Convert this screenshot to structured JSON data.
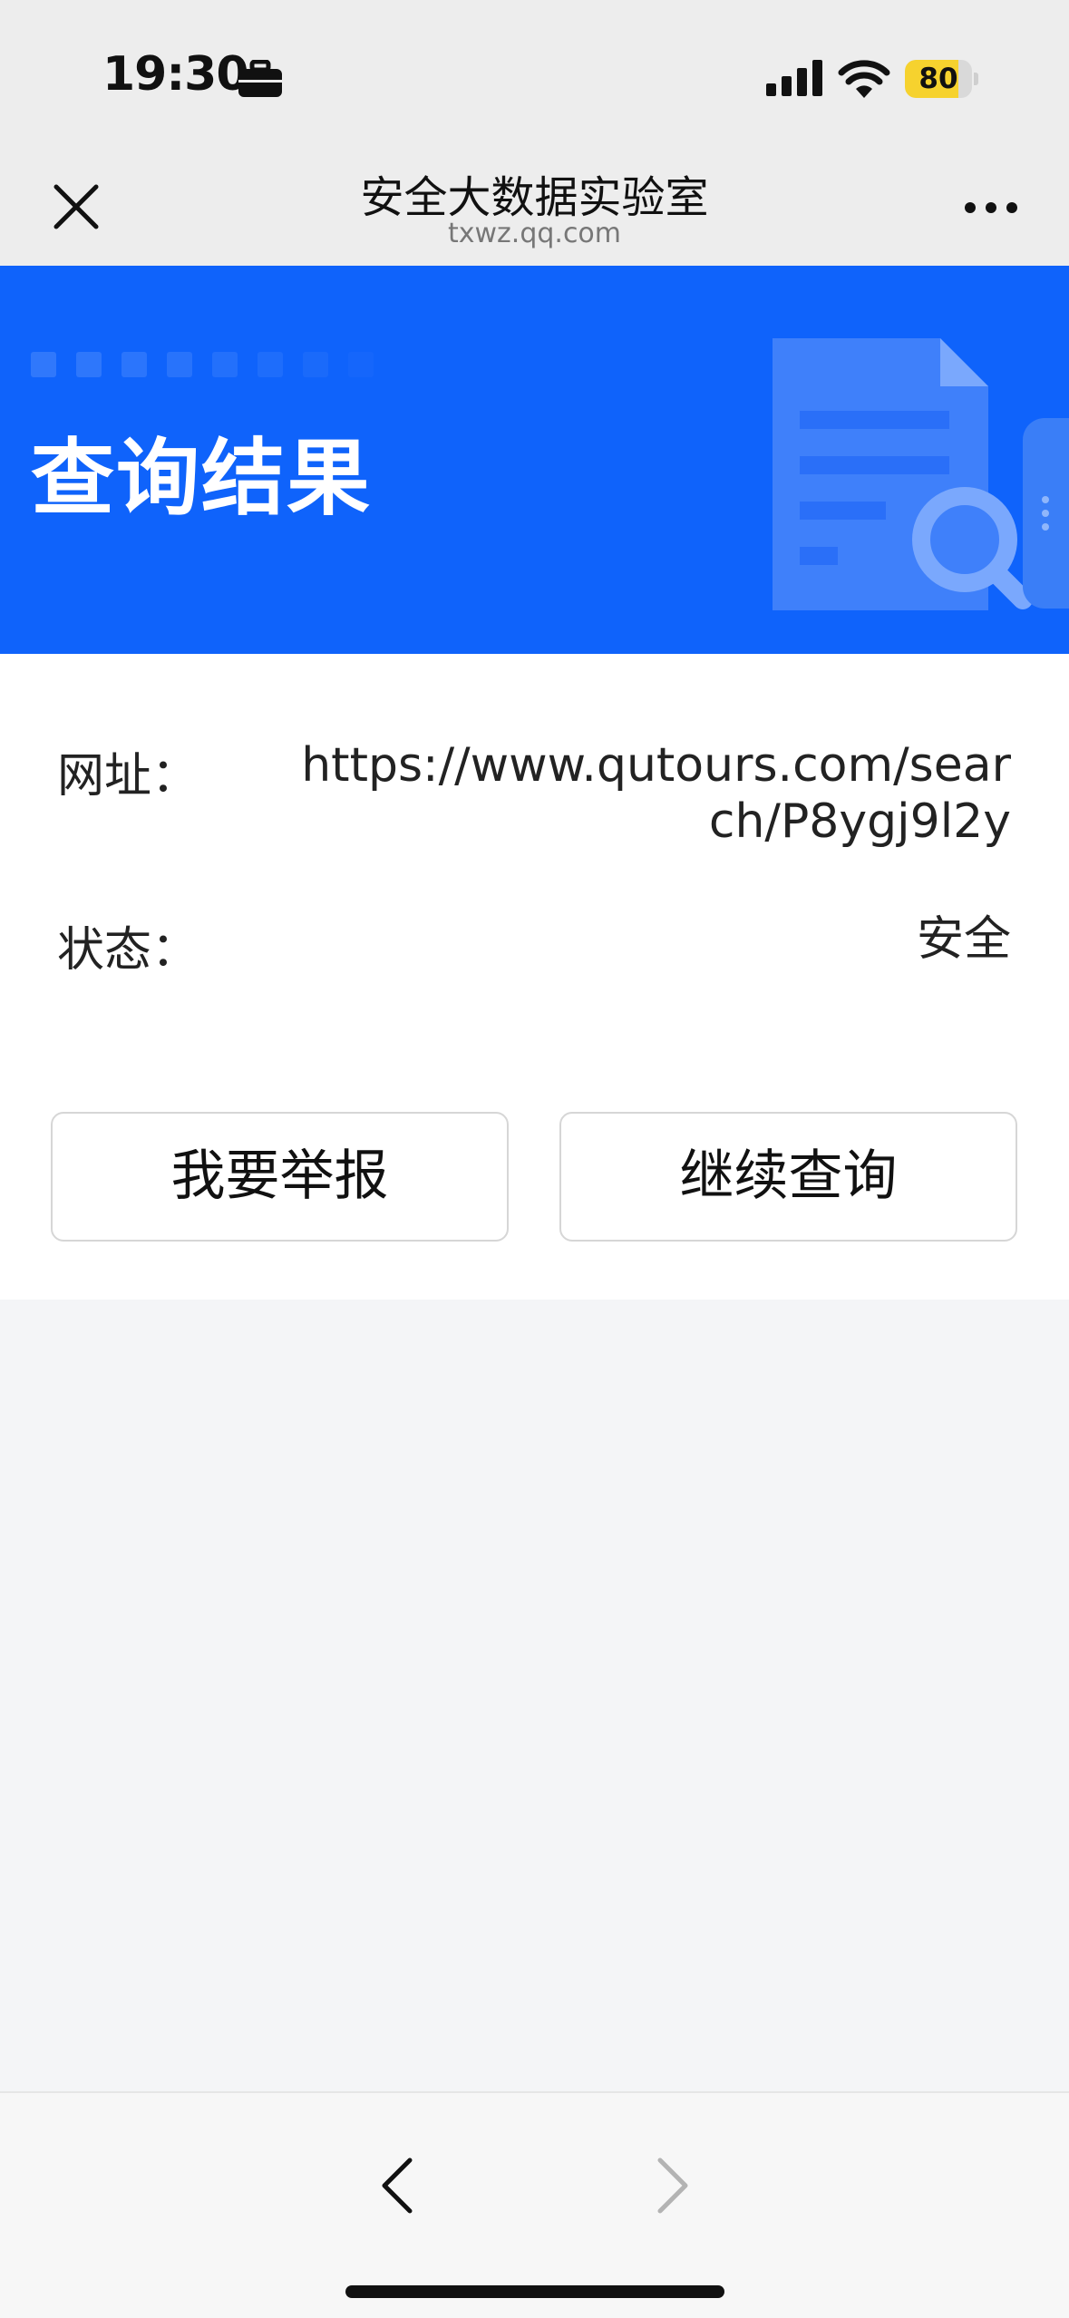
{
  "status_bar": {
    "time": "19:30",
    "battery_percent": "80",
    "battery_level": 0.8
  },
  "nav": {
    "title": "安全大数据实验室",
    "domain": "txwz.qq.com"
  },
  "banner": {
    "title": "查询结果"
  },
  "result": {
    "url_label": "网址：",
    "url_value": "https://www.qutours.com/search/P8ygj9l2y",
    "status_label": "状态：",
    "status_value": "安全"
  },
  "actions": {
    "report_label": "我要举报",
    "continue_label": "继续查询"
  },
  "colors": {
    "banner_blue": "#0f63fb",
    "battery_yellow": "#f6d22e"
  },
  "icons": [
    "briefcase-icon",
    "signal-icon",
    "wifi-icon",
    "close-icon",
    "more-icon",
    "document-search-icon",
    "back-icon",
    "forward-icon"
  ]
}
